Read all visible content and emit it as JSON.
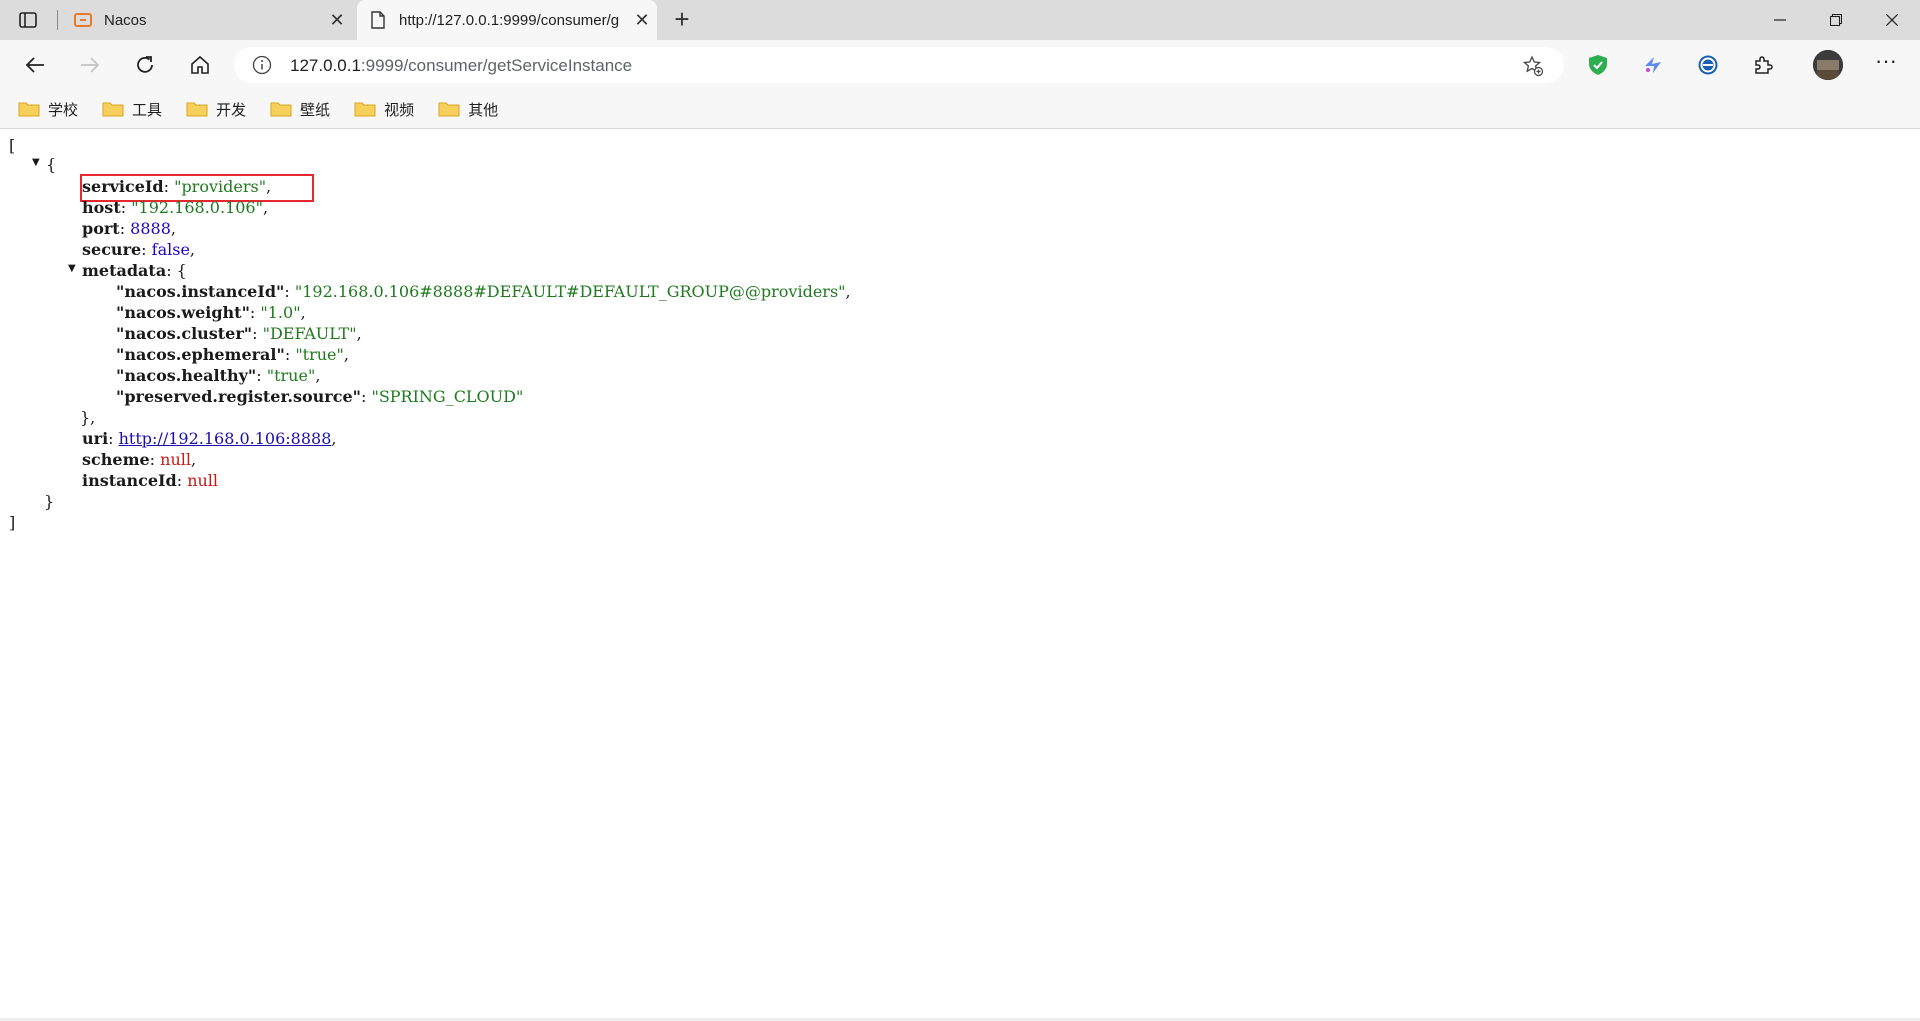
{
  "window": {
    "tabs": [
      {
        "title": "Nacos",
        "active": false
      },
      {
        "title": "http://127.0.0.1:9999/consumer/g",
        "active": true
      }
    ]
  },
  "toolbar": {
    "url_host": "127.0.0.1",
    "url_path": ":9999/consumer/getServiceInstance"
  },
  "bookmarks": [
    "学校",
    "工具",
    "开发",
    "壁纸",
    "视频",
    "其他"
  ],
  "json_view": {
    "open_bracket": "[",
    "close_bracket": "]",
    "open_brace": "{",
    "close_brace": "}",
    "serviceId_key": "serviceId",
    "serviceId_val": "\"providers\"",
    "host_key": "host",
    "host_val": "\"192.168.0.106\"",
    "port_key": "port",
    "port_val": "8888",
    "secure_key": "secure",
    "secure_val": "false",
    "metadata_key": "metadata",
    "meta": [
      {
        "key": "\"nacos.instanceId\"",
        "val": "\"192.168.0.106#8888#DEFAULT#DEFAULT_GROUP@@providers\"",
        "comma": ","
      },
      {
        "key": "\"nacos.weight\"",
        "val": "\"1.0\"",
        "comma": ","
      },
      {
        "key": "\"nacos.cluster\"",
        "val": "\"DEFAULT\"",
        "comma": ","
      },
      {
        "key": "\"nacos.ephemeral\"",
        "val": "\"true\"",
        "comma": ","
      },
      {
        "key": "\"nacos.healthy\"",
        "val": "\"true\"",
        "comma": ","
      },
      {
        "key": "\"preserved.register.source\"",
        "val": "\"SPRING_CLOUD\"",
        "comma": ""
      }
    ],
    "metadata_close": "},",
    "uri_key": "uri",
    "uri_val": "http://192.168.0.106:8888",
    "scheme_key": "scheme",
    "scheme_val": "null",
    "instanceId_key": "instanceId",
    "instanceId_val": "null"
  },
  "colors": {
    "highlight_box": "#e8262d",
    "string": "#1f7a1f",
    "number": "#1c00cf",
    "null": "#c41a16"
  }
}
